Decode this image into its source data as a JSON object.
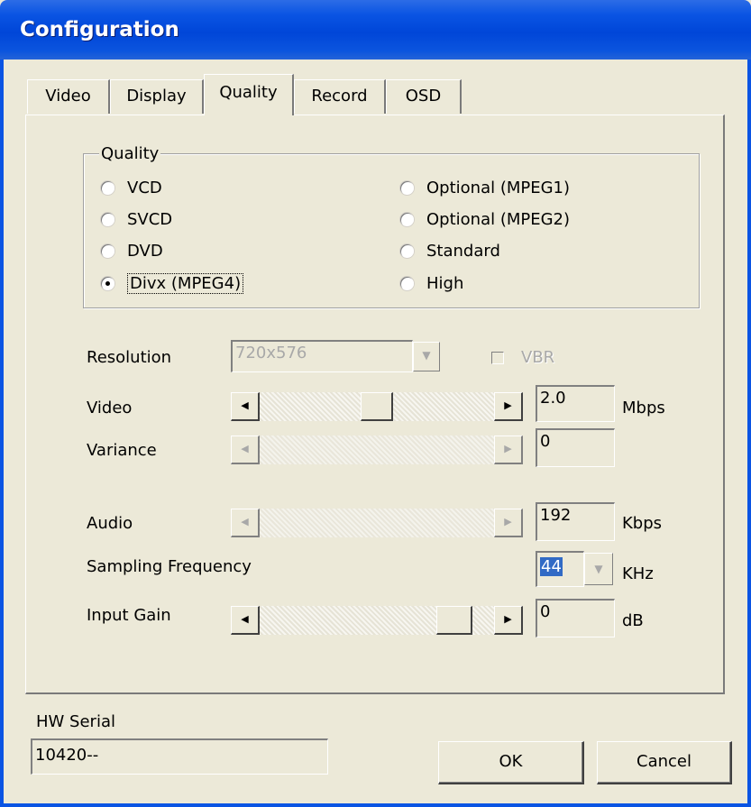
{
  "window": {
    "title": "Configuration"
  },
  "tabs": [
    "Video",
    "Display",
    "Quality",
    "Record",
    "OSD"
  ],
  "active_tab": "Quality",
  "quality_group": {
    "legend": "Quality",
    "options_left": [
      "VCD",
      "SVCD",
      "DVD",
      "Divx (MPEG4)"
    ],
    "options_right": [
      "Optional (MPEG1)",
      "Optional (MPEG2)",
      "Standard",
      "High"
    ],
    "selected": "Divx (MPEG4)"
  },
  "resolution": {
    "label": "Resolution",
    "value": "720x576",
    "enabled": false
  },
  "vbr": {
    "label": "VBR",
    "checked": false,
    "enabled": false
  },
  "video": {
    "label": "Video",
    "value": "2.0",
    "unit": "Mbps",
    "slider_fraction": 0.45
  },
  "variance": {
    "label": "Variance",
    "value": "0",
    "unit": "",
    "enabled": false
  },
  "audio": {
    "label": "Audio",
    "value": "192",
    "unit": "Kbps",
    "enabled": false
  },
  "sampling": {
    "label": "Sampling Frequency",
    "value": "44",
    "unit": "KHz"
  },
  "input_gain": {
    "label": "Input Gain",
    "value": "0",
    "unit": "dB",
    "slider_fraction": 0.9
  },
  "hw_serial": {
    "label": "HW Serial",
    "value": "10420--"
  },
  "buttons": {
    "ok": "OK",
    "cancel": "Cancel"
  },
  "icons": {
    "scroll_left": "◀",
    "scroll_right": "▶",
    "dropdown": "▼"
  },
  "colors": {
    "titlebar": "#0a54e3",
    "dialog_bg": "#ece9d8",
    "selection": "#316ac5",
    "disabled_text": "#a8a8a8"
  }
}
